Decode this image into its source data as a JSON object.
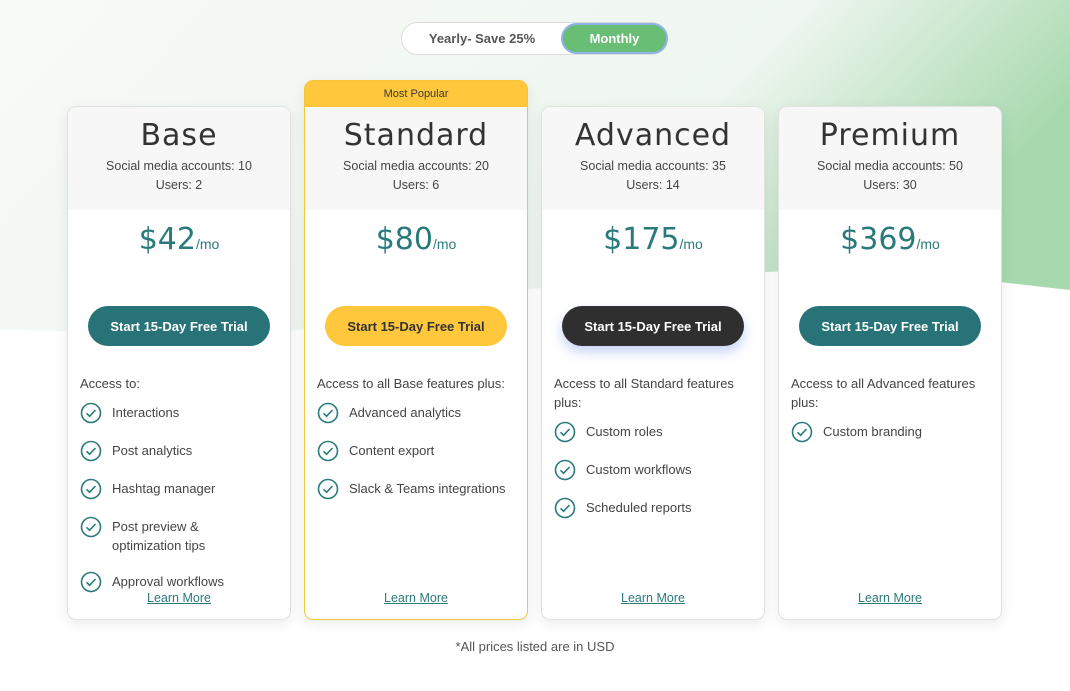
{
  "billing_toggle": {
    "yearly_label": "Yearly- Save 25%",
    "monthly_label": "Monthly",
    "selected": "Monthly"
  },
  "colors": {
    "teal": "#277377",
    "yellow": "#fec73c",
    "dark": "#2f2f2f",
    "green": "#67be74"
  },
  "plans": [
    {
      "name": "Base",
      "accounts": "Social media accounts: 10",
      "users": "Users: 2",
      "price": "$42",
      "per": "/mo",
      "cta": "Start 15-Day Free Trial",
      "access": "Access to:",
      "features": [
        "Interactions",
        "Post analytics",
        "Hashtag manager",
        "Post preview & optimization tips",
        "Approval workflows"
      ],
      "learn_more": "Learn More"
    },
    {
      "ribbon": "Most Popular",
      "name": "Standard",
      "accounts": "Social media accounts: 20",
      "users": "Users: 6",
      "price": "$80",
      "per": "/mo",
      "cta": "Start 15-Day Free Trial",
      "access": "Access to all Base features plus:",
      "features": [
        "Advanced analytics",
        "Content export",
        "Slack & Teams integrations"
      ],
      "learn_more": "Learn More"
    },
    {
      "name": "Advanced",
      "accounts": "Social media accounts: 35",
      "users": "Users: 14",
      "price": "$175",
      "per": "/mo",
      "cta": "Start 15-Day Free Trial",
      "access": "Access to all Standard features plus:",
      "features": [
        "Custom roles",
        "Custom workflows",
        "Scheduled reports"
      ],
      "learn_more": "Learn More"
    },
    {
      "name": "Premium",
      "accounts": "Social media accounts: 50",
      "users": "Users: 30",
      "price": "$369",
      "per": "/mo",
      "cta": "Start 15-Day Free Trial",
      "access": "Access to all Advanced features plus:",
      "features": [
        "Custom branding"
      ],
      "learn_more": "Learn More"
    }
  ],
  "footnote": "*All prices listed are in USD"
}
